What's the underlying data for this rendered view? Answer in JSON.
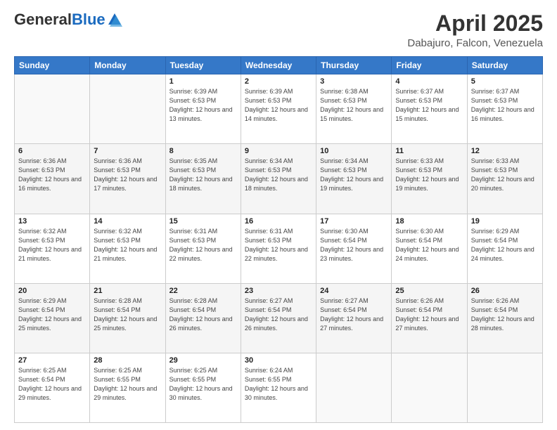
{
  "header": {
    "logo_general": "General",
    "logo_blue": "Blue",
    "main_title": "April 2025",
    "subtitle": "Dabajuro, Falcon, Venezuela"
  },
  "days_of_week": [
    "Sunday",
    "Monday",
    "Tuesday",
    "Wednesday",
    "Thursday",
    "Friday",
    "Saturday"
  ],
  "weeks": [
    [
      {
        "day": "",
        "info": ""
      },
      {
        "day": "",
        "info": ""
      },
      {
        "day": "1",
        "info": "Sunrise: 6:39 AM\nSunset: 6:53 PM\nDaylight: 12 hours and 13 minutes."
      },
      {
        "day": "2",
        "info": "Sunrise: 6:39 AM\nSunset: 6:53 PM\nDaylight: 12 hours and 14 minutes."
      },
      {
        "day": "3",
        "info": "Sunrise: 6:38 AM\nSunset: 6:53 PM\nDaylight: 12 hours and 15 minutes."
      },
      {
        "day": "4",
        "info": "Sunrise: 6:37 AM\nSunset: 6:53 PM\nDaylight: 12 hours and 15 minutes."
      },
      {
        "day": "5",
        "info": "Sunrise: 6:37 AM\nSunset: 6:53 PM\nDaylight: 12 hours and 16 minutes."
      }
    ],
    [
      {
        "day": "6",
        "info": "Sunrise: 6:36 AM\nSunset: 6:53 PM\nDaylight: 12 hours and 16 minutes."
      },
      {
        "day": "7",
        "info": "Sunrise: 6:36 AM\nSunset: 6:53 PM\nDaylight: 12 hours and 17 minutes."
      },
      {
        "day": "8",
        "info": "Sunrise: 6:35 AM\nSunset: 6:53 PM\nDaylight: 12 hours and 18 minutes."
      },
      {
        "day": "9",
        "info": "Sunrise: 6:34 AM\nSunset: 6:53 PM\nDaylight: 12 hours and 18 minutes."
      },
      {
        "day": "10",
        "info": "Sunrise: 6:34 AM\nSunset: 6:53 PM\nDaylight: 12 hours and 19 minutes."
      },
      {
        "day": "11",
        "info": "Sunrise: 6:33 AM\nSunset: 6:53 PM\nDaylight: 12 hours and 19 minutes."
      },
      {
        "day": "12",
        "info": "Sunrise: 6:33 AM\nSunset: 6:53 PM\nDaylight: 12 hours and 20 minutes."
      }
    ],
    [
      {
        "day": "13",
        "info": "Sunrise: 6:32 AM\nSunset: 6:53 PM\nDaylight: 12 hours and 21 minutes."
      },
      {
        "day": "14",
        "info": "Sunrise: 6:32 AM\nSunset: 6:53 PM\nDaylight: 12 hours and 21 minutes."
      },
      {
        "day": "15",
        "info": "Sunrise: 6:31 AM\nSunset: 6:53 PM\nDaylight: 12 hours and 22 minutes."
      },
      {
        "day": "16",
        "info": "Sunrise: 6:31 AM\nSunset: 6:53 PM\nDaylight: 12 hours and 22 minutes."
      },
      {
        "day": "17",
        "info": "Sunrise: 6:30 AM\nSunset: 6:54 PM\nDaylight: 12 hours and 23 minutes."
      },
      {
        "day": "18",
        "info": "Sunrise: 6:30 AM\nSunset: 6:54 PM\nDaylight: 12 hours and 24 minutes."
      },
      {
        "day": "19",
        "info": "Sunrise: 6:29 AM\nSunset: 6:54 PM\nDaylight: 12 hours and 24 minutes."
      }
    ],
    [
      {
        "day": "20",
        "info": "Sunrise: 6:29 AM\nSunset: 6:54 PM\nDaylight: 12 hours and 25 minutes."
      },
      {
        "day": "21",
        "info": "Sunrise: 6:28 AM\nSunset: 6:54 PM\nDaylight: 12 hours and 25 minutes."
      },
      {
        "day": "22",
        "info": "Sunrise: 6:28 AM\nSunset: 6:54 PM\nDaylight: 12 hours and 26 minutes."
      },
      {
        "day": "23",
        "info": "Sunrise: 6:27 AM\nSunset: 6:54 PM\nDaylight: 12 hours and 26 minutes."
      },
      {
        "day": "24",
        "info": "Sunrise: 6:27 AM\nSunset: 6:54 PM\nDaylight: 12 hours and 27 minutes."
      },
      {
        "day": "25",
        "info": "Sunrise: 6:26 AM\nSunset: 6:54 PM\nDaylight: 12 hours and 27 minutes."
      },
      {
        "day": "26",
        "info": "Sunrise: 6:26 AM\nSunset: 6:54 PM\nDaylight: 12 hours and 28 minutes."
      }
    ],
    [
      {
        "day": "27",
        "info": "Sunrise: 6:25 AM\nSunset: 6:54 PM\nDaylight: 12 hours and 29 minutes."
      },
      {
        "day": "28",
        "info": "Sunrise: 6:25 AM\nSunset: 6:55 PM\nDaylight: 12 hours and 29 minutes."
      },
      {
        "day": "29",
        "info": "Sunrise: 6:25 AM\nSunset: 6:55 PM\nDaylight: 12 hours and 30 minutes."
      },
      {
        "day": "30",
        "info": "Sunrise: 6:24 AM\nSunset: 6:55 PM\nDaylight: 12 hours and 30 minutes."
      },
      {
        "day": "",
        "info": ""
      },
      {
        "day": "",
        "info": ""
      },
      {
        "day": "",
        "info": ""
      }
    ]
  ]
}
